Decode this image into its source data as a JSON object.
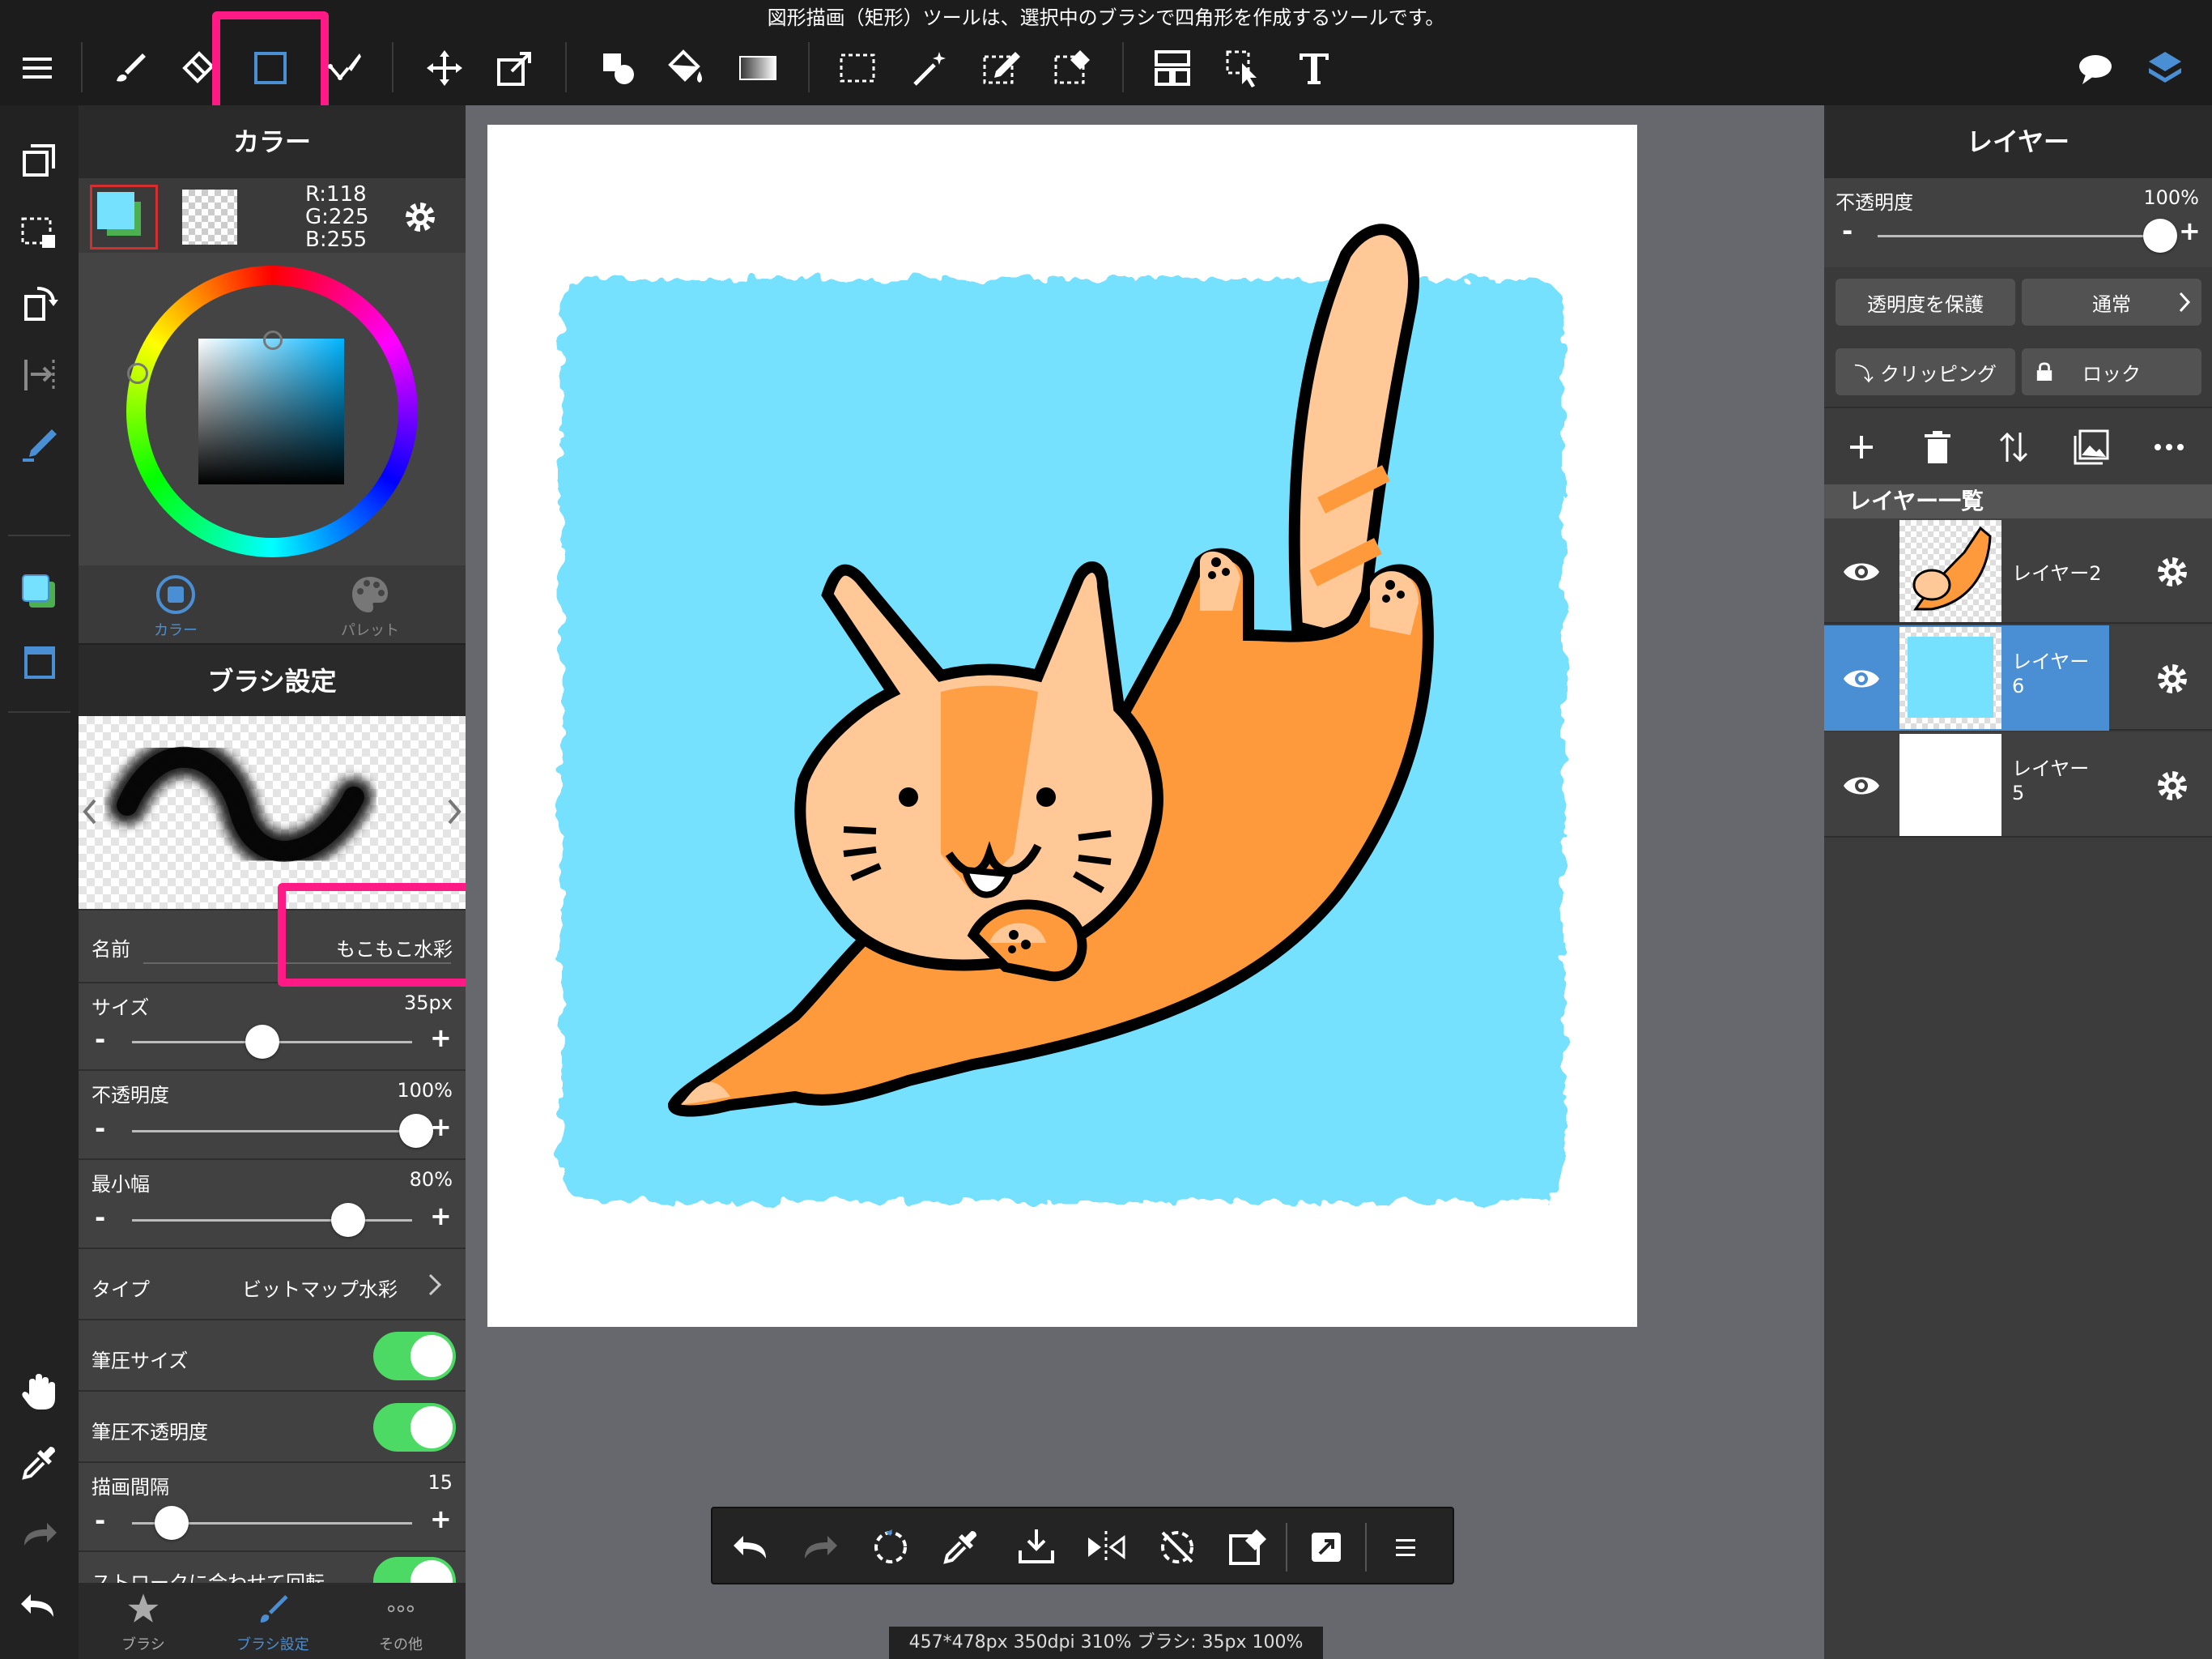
{
  "tooltip": "図形描画（矩形）ツールは、選択中のブラシで四角形を作成するツールです。",
  "toolbar": {
    "icons": [
      "menu-icon",
      "brush-icon",
      "eraser-icon",
      "rect-shape-icon",
      "pen-curve-icon",
      "move-icon",
      "transform-icon",
      "shape-fill-icon",
      "bucket-icon",
      "gradient-icon",
      "select-rect-icon",
      "magic-wand-icon",
      "select-pen-icon",
      "select-eraser-icon",
      "frame-divider-icon",
      "operation-icon",
      "text-icon",
      "comment-icon",
      "layers-icon"
    ]
  },
  "color_panel": {
    "title": "カラー",
    "r": "R:118",
    "g": "G:225",
    "b": "B:255",
    "fg_color": "#76e1ff",
    "tab_color": "カラー",
    "tab_palette": "パレット"
  },
  "brush_panel": {
    "title": "ブラシ設定",
    "name_label": "名前",
    "name_value": "もこもこ水彩",
    "size_label": "サイズ",
    "size_value": "35px",
    "size_level": 0.41,
    "opacity_label": "不透明度",
    "opacity_value": "100%",
    "opacity_level": 1.0,
    "minwidth_label": "最小幅",
    "minwidth_value": "80%",
    "minwidth_level": 0.8,
    "type_label": "タイプ",
    "type_value": "ビットマップ水彩",
    "pressure_size_label": "筆圧サイズ",
    "pressure_size_on": true,
    "pressure_opacity_label": "筆圧不透明度",
    "pressure_opacity_on": true,
    "interval_label": "描画間隔",
    "interval_value": "15",
    "interval_level": 0.14,
    "cut_label": "ストロークに合わせて回転"
  },
  "bottom_tabs": [
    "ブラシ",
    "ブラシ設定",
    "その他"
  ],
  "layer_panel": {
    "title": "レイヤー",
    "opacity_label": "不透明度",
    "opacity_value": "100%",
    "opacity_level": 1.0,
    "protect_label": "透明度を保護",
    "blend_label": "通常",
    "clipping_label": "クリッピング",
    "lock_label": "ロック",
    "list_title": "レイヤー一覧",
    "layers": [
      {
        "name": "レイヤー2",
        "selected": false
      },
      {
        "name": "レイヤー\n6",
        "selected": true
      },
      {
        "name": "レイヤー\n5",
        "selected": false
      }
    ]
  },
  "status_text": "457*478px 350dpi 310% ブラシ: 35px 100%",
  "colors": {
    "accent": "#4a8fd4",
    "highlight": "#ff1a85",
    "sky": "#76e1ff",
    "cat": "#ff9a3c",
    "cat_light": "#ffc896"
  }
}
